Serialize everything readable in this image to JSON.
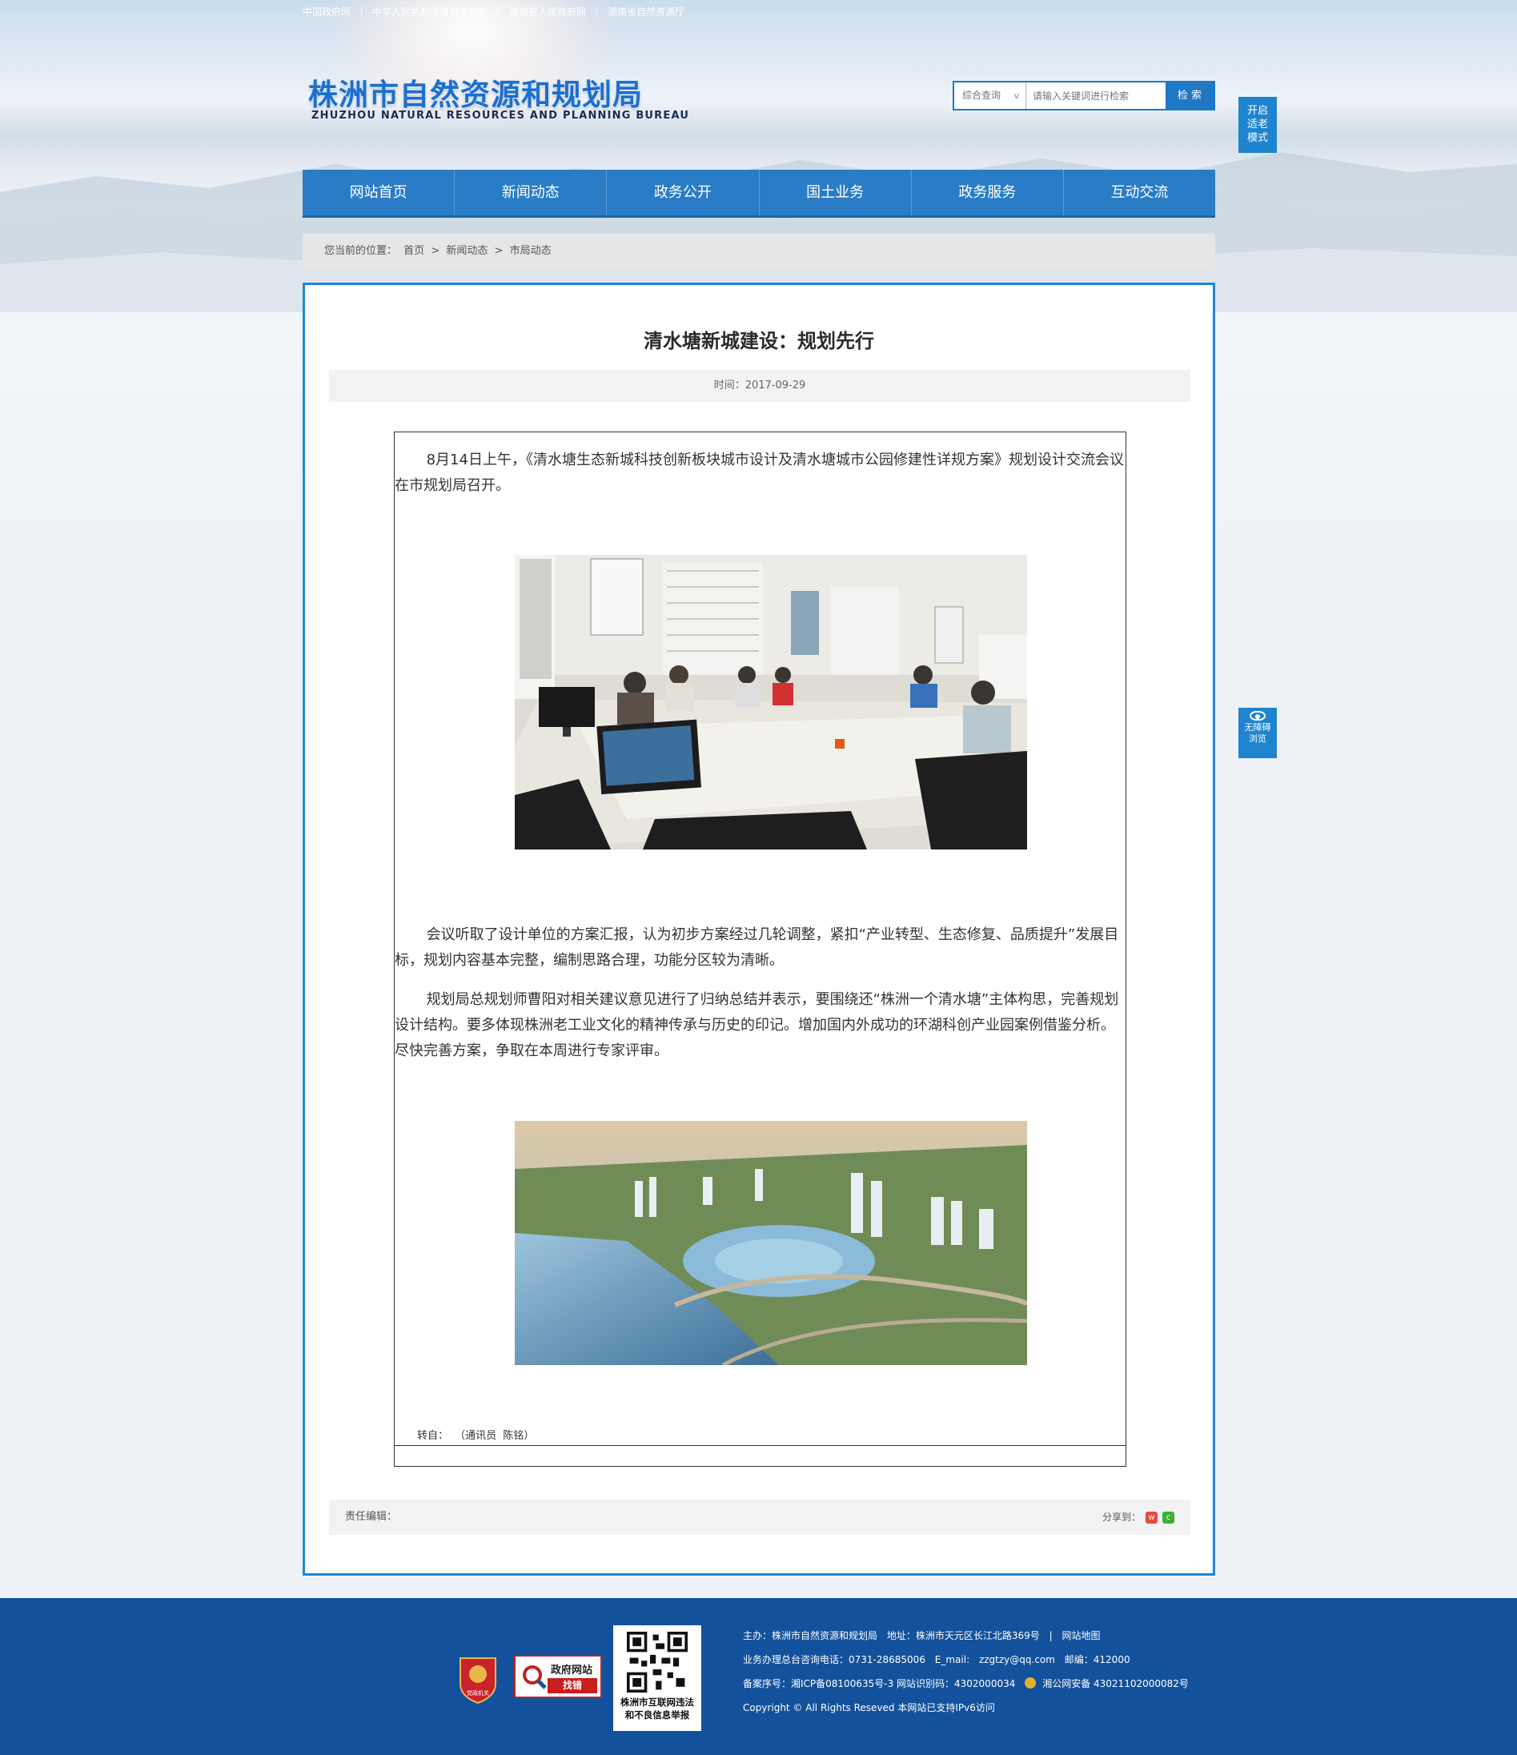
{
  "top_links": [
    "中国政府网",
    "中华人民共和国自然资源部",
    "湖南省人民政府网",
    "湖南省自然资源厅"
  ],
  "logo": {
    "cn": "株洲市自然资源和规划局",
    "en": "ZHUZHOU NATURAL RESOURCES AND PLANNING BUREAU"
  },
  "search": {
    "select": "综合查询",
    "arrow": "v",
    "placeholder": "请输入关键词进行检索",
    "button": "检 索"
  },
  "side_buttons": {
    "elderly": [
      "开启",
      "适老",
      "模式"
    ],
    "accessible": [
      "无障碍",
      "浏览"
    ]
  },
  "nav": [
    "网站首页",
    "新闻动态",
    "政务公开",
    "国土业务",
    "政务服务",
    "互动交流"
  ],
  "breadcrumb": {
    "label": "您当前的位置：",
    "items": [
      "首页",
      ">",
      "新闻动态",
      ">",
      "市局动态"
    ]
  },
  "article": {
    "title": "清水塘新城建设：规划先行",
    "time": "时间：2017-09-29",
    "paragraphs": [
      "8月14日上午，《清水塘生态新城科技创新板块城市设计及清水塘城市公园修建性详规方案》规划设计交流会议在市规划局召开。",
      "会议听取了设计单位的方案汇报，认为初步方案经过几轮调整，紧扣“产业转型、生态修复、品质提升”发展目标，规划内容基本完整，编制思路合理，功能分区较为清晰。",
      "规划局总规划师曹阳对相关建议意见进行了归纳总结并表示，要围绕还“株洲一个清水塘”主体构思，完善规划设计结构。要多体现株洲老工业文化的精神传承与历史的印记。增加国内外成功的环湖科创产业园案例借鉴分析。尽快完善方案，争取在本周进行专家评审。"
    ],
    "source": [
      "转自：",
      "（通讯员",
      "陈铭）"
    ],
    "editor": "责任编辑：",
    "share": "分享到："
  },
  "footer": {
    "badge1": "党政机关",
    "badge2_top": "政府网站",
    "badge2_bottom": "找错",
    "qr_text": [
      "株洲市互联网违法",
      "和不良信息举报"
    ],
    "line1": [
      "主办：株洲市自然资源和规划局",
      "地址：株洲市天元区长江北路369号",
      "|",
      "网站地图"
    ],
    "line2": [
      "业务办理总台咨询电话：0731-28685006",
      "E_mail:",
      "zzgtzy@qq.com",
      "邮编：412000"
    ],
    "line3": [
      "备案序号：湘ICP备08100635号-3 网站识别码：4302000034",
      "湘公网安备 43021102000082号"
    ],
    "line4": "Copyright © All Rights Reseved 本网站已支持IPv6访问"
  }
}
